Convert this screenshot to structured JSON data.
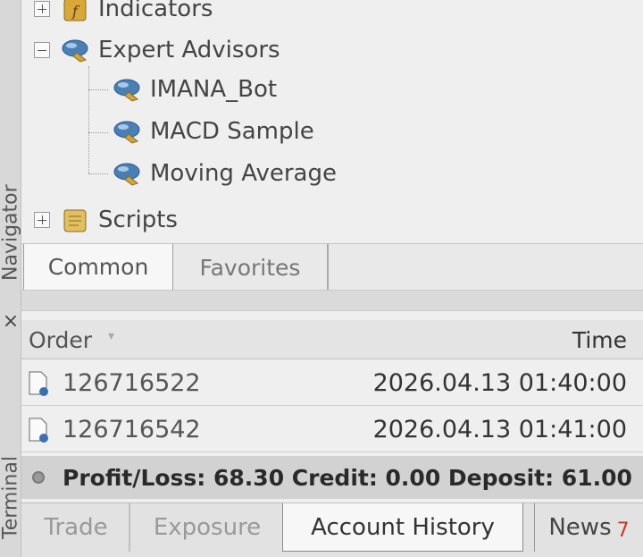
{
  "side": {
    "navigator_label": "Navigator",
    "terminal_label": "Terminal",
    "close_glyph": "×"
  },
  "navigator": {
    "tree": {
      "indicators": "Indicators",
      "expert_advisors": "Expert Advisors",
      "experts": [
        "IMANA_Bot",
        "MACD Sample",
        "Moving Average"
      ],
      "scripts": "Scripts"
    },
    "tabs": [
      "Common",
      "Favorites"
    ]
  },
  "terminal": {
    "columns": {
      "order": "Order",
      "time": "Time"
    },
    "rows": [
      {
        "order": "126716522",
        "time": "2026.04.13 01:40:00"
      },
      {
        "order": "126716542",
        "time": "2026.04.13 01:41:00"
      }
    ],
    "summary": "Profit/Loss: 68.30  Credit: 0.00  Deposit: 61.00",
    "tabs": {
      "trade": "Trade",
      "exposure": "Exposure",
      "account_history": "Account History",
      "news": "News",
      "news_badge": "7"
    }
  },
  "colors": {
    "badge": "#c0392b",
    "expert_icon_blue": "#4a7fb5",
    "expert_icon_gold": "#d1a53a"
  }
}
